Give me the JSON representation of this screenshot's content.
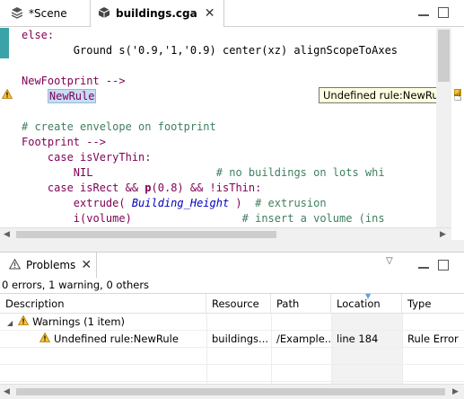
{
  "editor_tabs": [
    {
      "label": "*Scene",
      "icon": "layers-icon"
    },
    {
      "label": "buildings.cga",
      "icon": "cga-file-icon"
    }
  ],
  "code_lines": [
    {
      "text": "    else:"
    },
    {
      "text": "        Ground s('0.9,'1,'0.9) center(xz) alignScopeToAxes"
    },
    {
      "text": ""
    },
    {
      "text": "NewFootprint -->"
    },
    {
      "text": "    NewRule"
    },
    {
      "text": ""
    },
    {
      "text": "# create envelope on footprint"
    },
    {
      "text": "Footprint -->"
    },
    {
      "text": "    case isVeryThin:"
    },
    {
      "text": "        NIL                   # no buildings on lots whi"
    },
    {
      "text": "    case isRect && p(0.8) && !isThin:"
    },
    {
      "text": "        extrude( Building_Height )  # extrusion"
    },
    {
      "text": "        i(volume)                 # insert a volume (ins"
    }
  ],
  "code_tokens": {
    "else": "else:",
    "ground_line": "        Ground s('0.9,'1,'0.9) center(xz) alignScopeToAxes",
    "newfootprint": "NewFootprint -->",
    "newrule": "NewRule",
    "comment_envelope": "# create envelope on footprint",
    "footprint": "Footprint -->",
    "case1_kw": "case",
    "case1_rest": " isVeryThin:",
    "nil": "NIL",
    "nil_comment": "# no buildings on lots whi",
    "case2_kw": "case",
    "case2_a": " isRect && ",
    "case2_p": "p",
    "case2_b": "(0.8) && !isThin:",
    "extrude_a": "extrude( ",
    "extrude_param": "Building_Height",
    "extrude_b": " )  ",
    "extrude_comment": "# extrusion",
    "insert_a": "i(volume)                 ",
    "insert_comment": "# insert a volume (ins"
  },
  "tooltip": "Undefined rule:NewRule",
  "problems_view": {
    "tab_label": "Problems",
    "summary": "0 errors, 1 warning, 0 others",
    "columns": [
      "Description",
      "Resource",
      "Path",
      "Location",
      "Type"
    ],
    "group": {
      "label": "Warnings (1 item)"
    },
    "rows": [
      {
        "description": "Undefined rule:NewRule",
        "resource": "buildings....",
        "path": "/Example...",
        "location": "line 184",
        "type": "Rule Error"
      }
    ]
  },
  "colors": {
    "keyword": "#7f0055",
    "comment": "#3f7f5f",
    "warning": "#f6c23a",
    "selection": "#c6ddf5"
  }
}
